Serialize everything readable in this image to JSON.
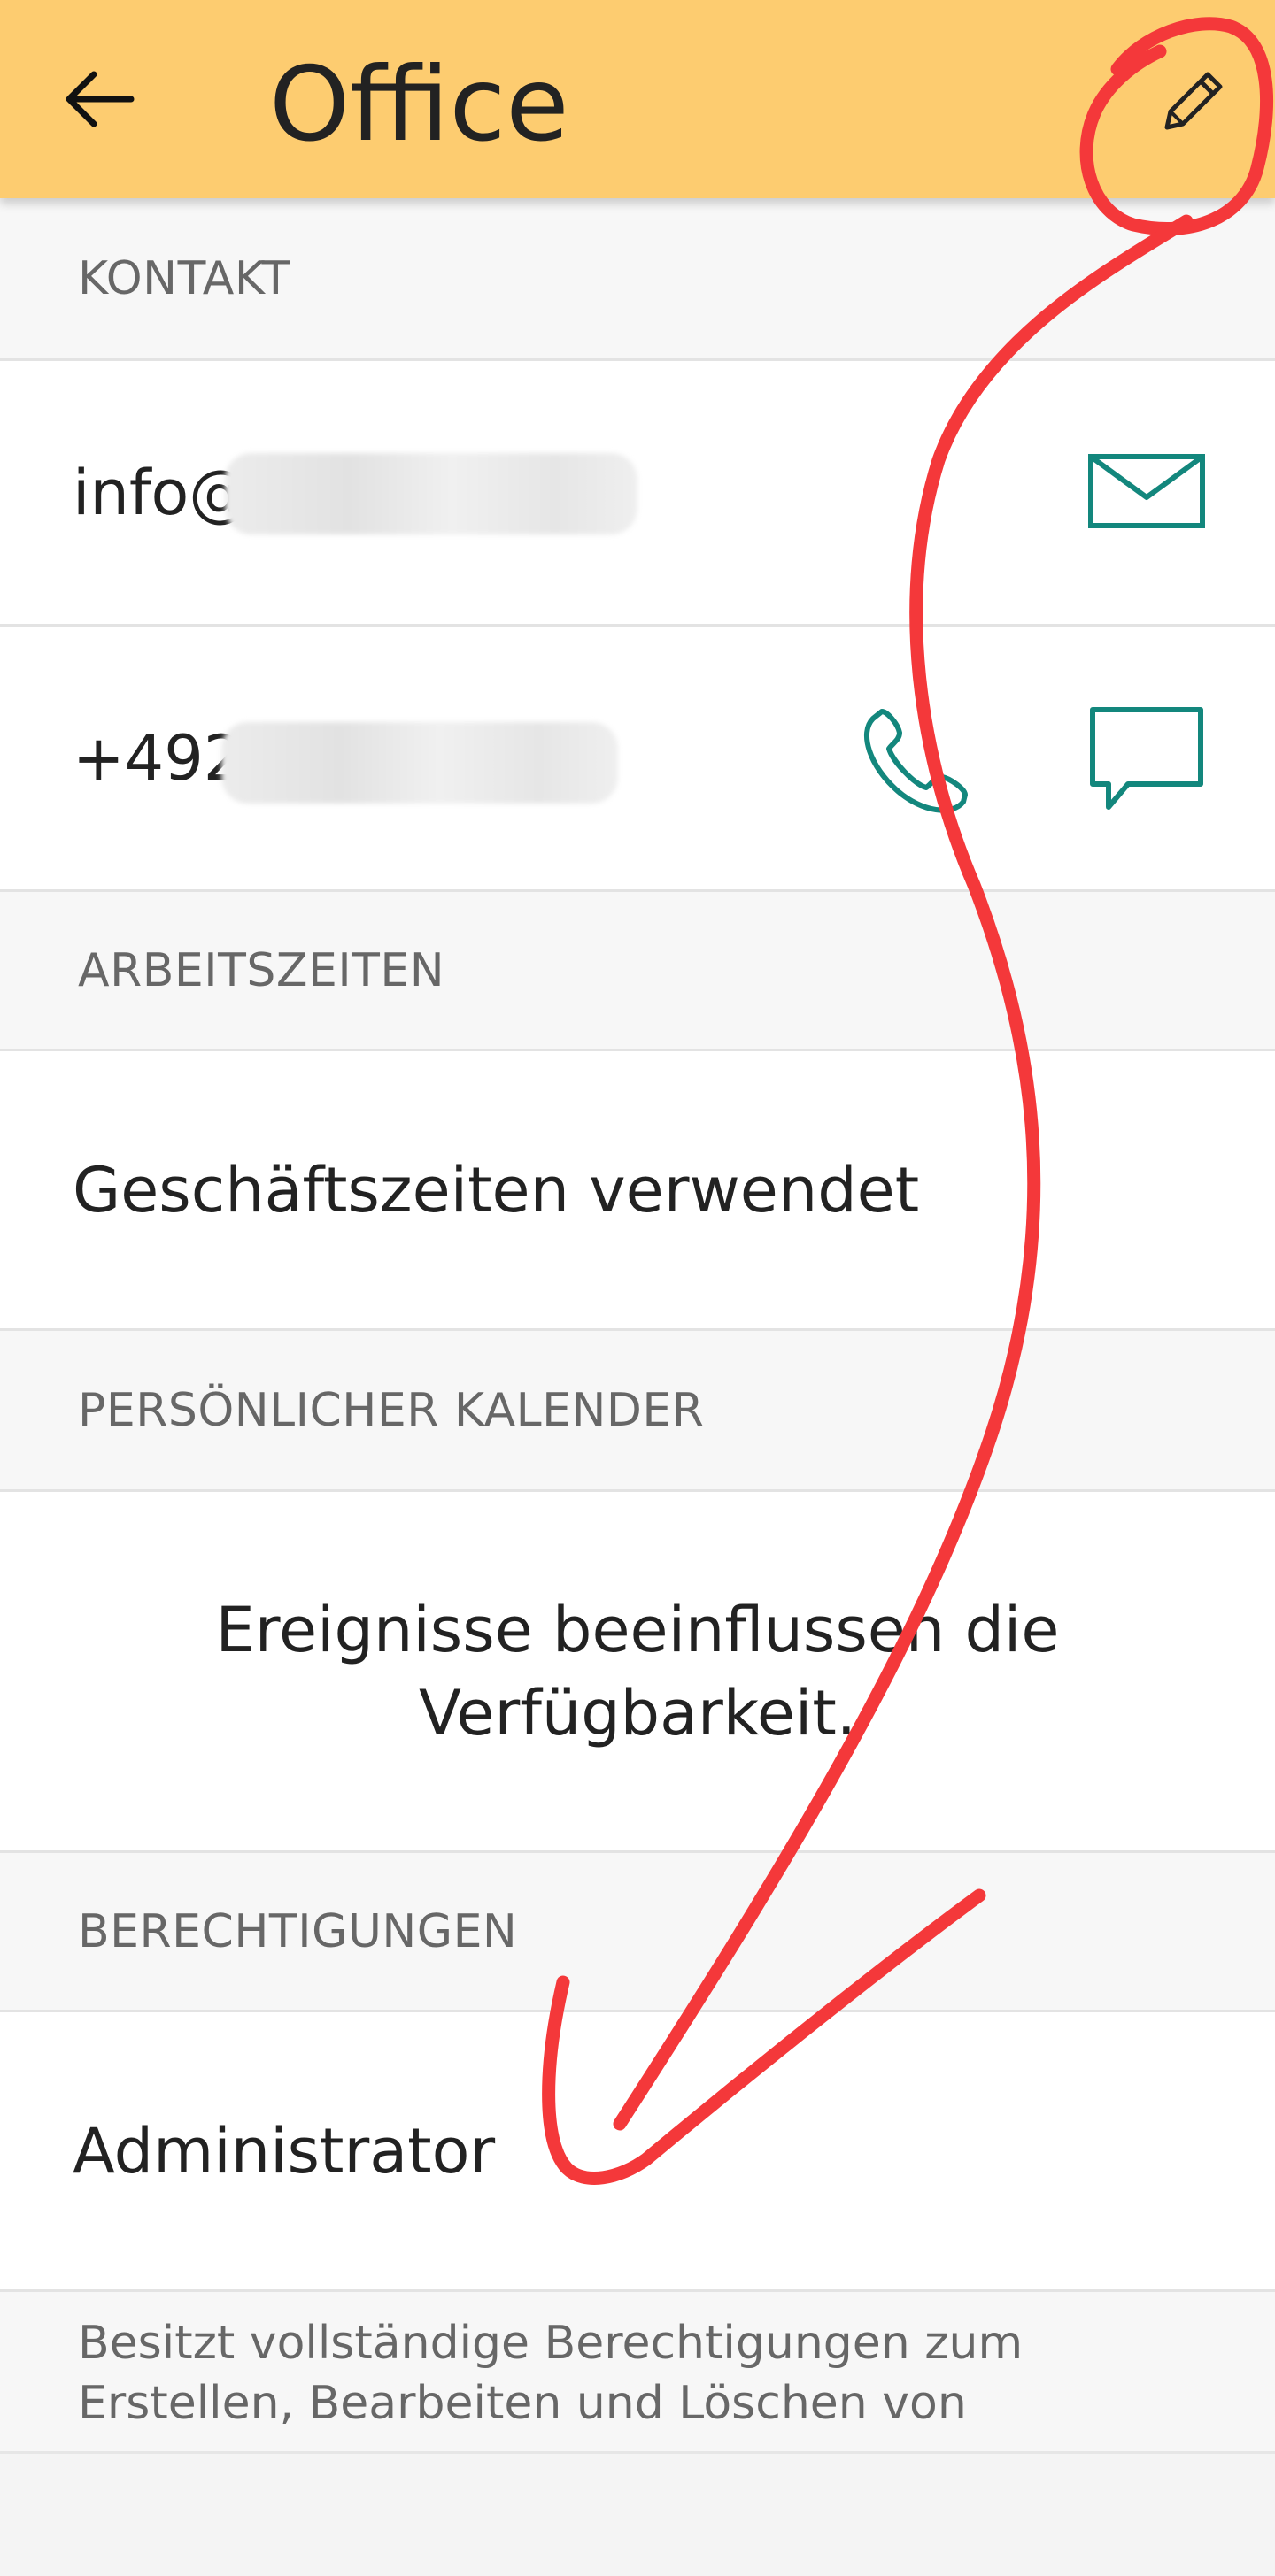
{
  "app_bar": {
    "title": "Office",
    "back_icon": "arrow-left-icon",
    "edit_icon": "pencil-icon",
    "background": "#fdcc70"
  },
  "sections": {
    "contact": {
      "header": "KONTAKT",
      "email_prefix": "info@",
      "phone_prefix": "+492",
      "email_icon": "envelope-icon",
      "phone_icon": "phone-icon",
      "message_icon": "chat-bubble-icon",
      "icon_color": "#13877d"
    },
    "work_hours": {
      "header": "ARBEITSZEITEN",
      "value": "Geschäftszeiten verwendet"
    },
    "calendar": {
      "header": "PERSÖNLICHER KALENDER",
      "line1": "Ereignisse beeinflussen die",
      "line2": "Verfügbarkeit."
    },
    "permissions": {
      "header": "BERECHTIGUNGEN",
      "role": "Administrator",
      "description": "Besitzt vollständige Berechtigungen zum Erstellen, Bearbeiten und Löschen von"
    }
  },
  "annotation": {
    "color": "#f4383a"
  }
}
